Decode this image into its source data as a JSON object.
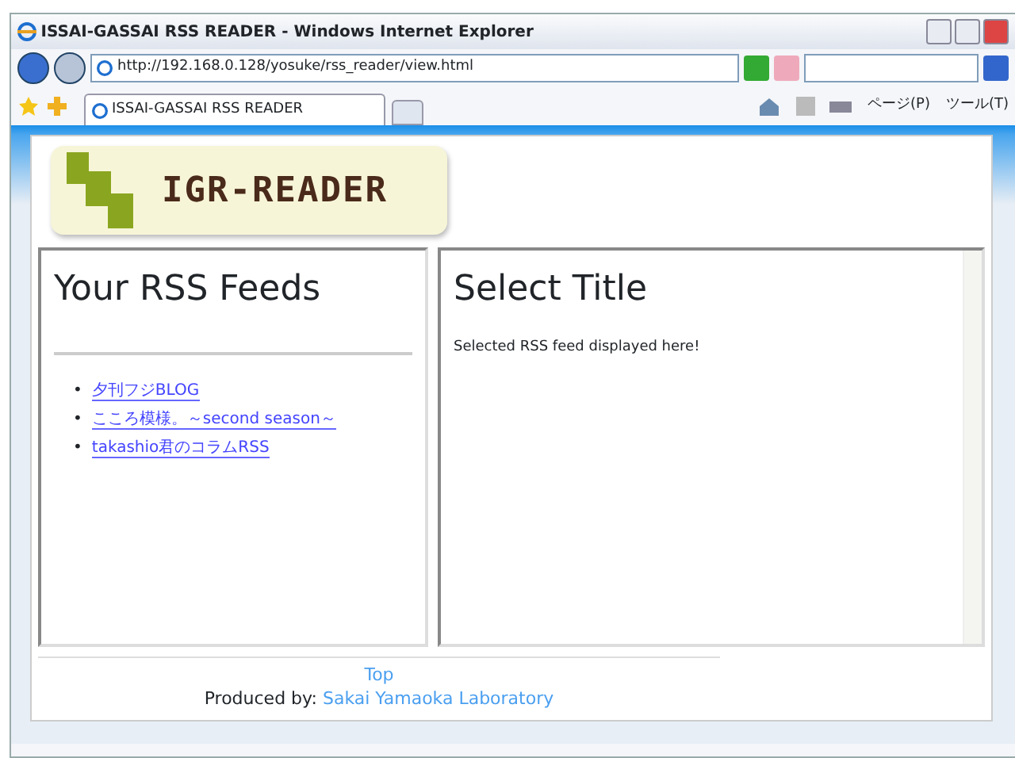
{
  "window": {
    "title": "ISSAI-GASSAI RSS READER - Windows Internet Explorer"
  },
  "address_bar": {
    "url": "http://192.168.0.128/yosuke/rss_reader/view.html"
  },
  "tabs": [
    {
      "label": "ISSAI-GASSAI RSS READER",
      "selected": true
    }
  ],
  "toolbar": {
    "page_menu": "ページ(P)",
    "tools_menu": "ツール(T)"
  },
  "logo": {
    "text": "IGR-READER"
  },
  "feeds_panel": {
    "title": "Your RSS Feeds",
    "feeds": [
      {
        "bullet": "•",
        "title": "夕刊フジBLOG"
      },
      {
        "bullet": "•",
        "title": "こころ模様。～second season～"
      },
      {
        "bullet": "•",
        "title": "takashio君のコラムRSS"
      }
    ]
  },
  "content_panel": {
    "title": "Select Title",
    "body": "Selected RSS feed displayed here!"
  },
  "footer": {
    "top_link": "Top",
    "produced_label": "Produced by:",
    "producer_link": "Sakai Yamaoka Laboratory"
  }
}
